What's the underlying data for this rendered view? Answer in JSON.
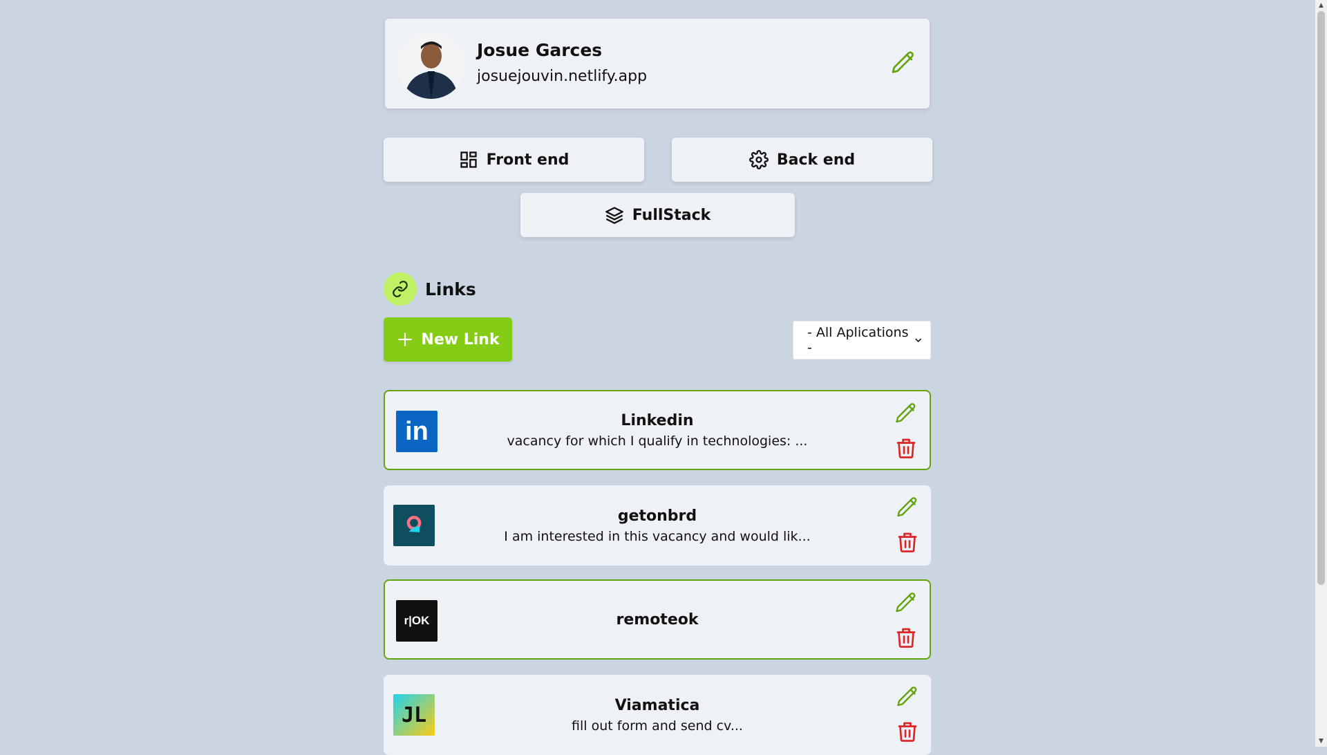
{
  "profile": {
    "name": "Josue Garces",
    "url": "josuejouvin.netlify.app"
  },
  "categories": {
    "front_end": "Front end",
    "back_end": "Back end",
    "full_stack": "FullStack"
  },
  "links_section": {
    "title": "Links",
    "new_link_label": "New Link",
    "filter_selected": "- All Aplications -"
  },
  "links": [
    {
      "title": "Linkedin",
      "description": "vacancy for which I qualify in technologies: ...",
      "logo_text": "in",
      "logo_color": "#0a66c2"
    },
    {
      "title": "getonbrd",
      "description": "I am interested in this vacancy and would lik...",
      "logo_color": "#0e4e5e"
    },
    {
      "title": "remoteok",
      "description": "",
      "logo_text": "r|OK",
      "logo_color": "#111111"
    },
    {
      "title": "Viamatica",
      "description": "fill out form and send cv...",
      "logo_text": "JL"
    }
  ],
  "colors": {
    "accent": "#84cc16",
    "background": "#cbd5e1",
    "card": "#eef2f7",
    "delete": "#dc2626",
    "edit": "#65a30d"
  }
}
